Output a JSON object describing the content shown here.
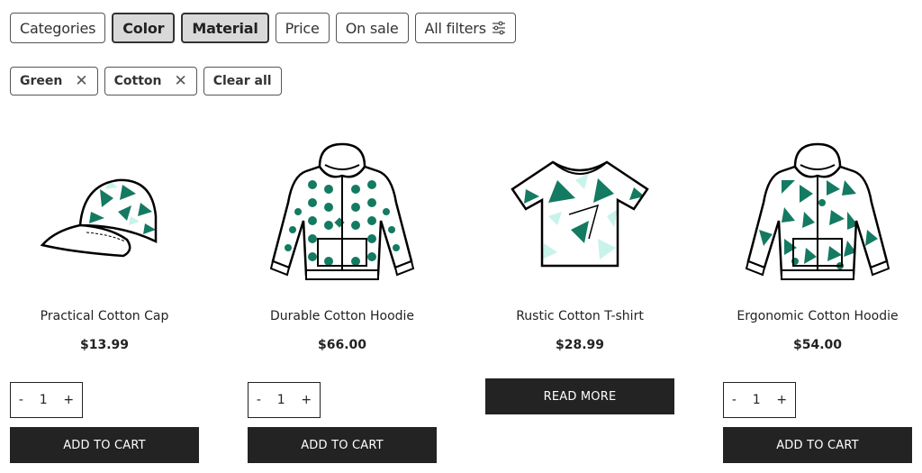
{
  "filters": [
    {
      "label": "Categories",
      "active": false
    },
    {
      "label": "Color",
      "active": true
    },
    {
      "label": "Material",
      "active": true
    },
    {
      "label": "Price",
      "active": false
    },
    {
      "label": "On sale",
      "active": false
    },
    {
      "label": "All filters",
      "active": false,
      "icon": "sliders-icon"
    }
  ],
  "active_chips": [
    {
      "label": "Green",
      "icon": "close-icon"
    },
    {
      "label": "Cotton",
      "icon": "close-icon"
    }
  ],
  "clear_all": "Clear all",
  "colors": {
    "green": "#147a62",
    "mint": "#c8f3ea",
    "button": "#232323"
  },
  "products": [
    {
      "name": "Practical Cotton Cap",
      "price": "$13.99",
      "image": "cap",
      "qty": "1",
      "action": "ADD TO CART"
    },
    {
      "name": "Durable Cotton Hoodie",
      "price": "$66.00",
      "image": "hoodie-dots",
      "qty": "1",
      "action": "ADD TO CART"
    },
    {
      "name": "Rustic Cotton T-shirt",
      "price": "$28.99",
      "image": "tshirt",
      "qty": null,
      "action": "READ MORE"
    },
    {
      "name": "Ergonomic Cotton Hoodie",
      "price": "$54.00",
      "image": "hoodie-triangles",
      "qty": "1",
      "action": "ADD TO CART"
    }
  ],
  "qty_controls": {
    "minus": "-",
    "plus": "+"
  }
}
